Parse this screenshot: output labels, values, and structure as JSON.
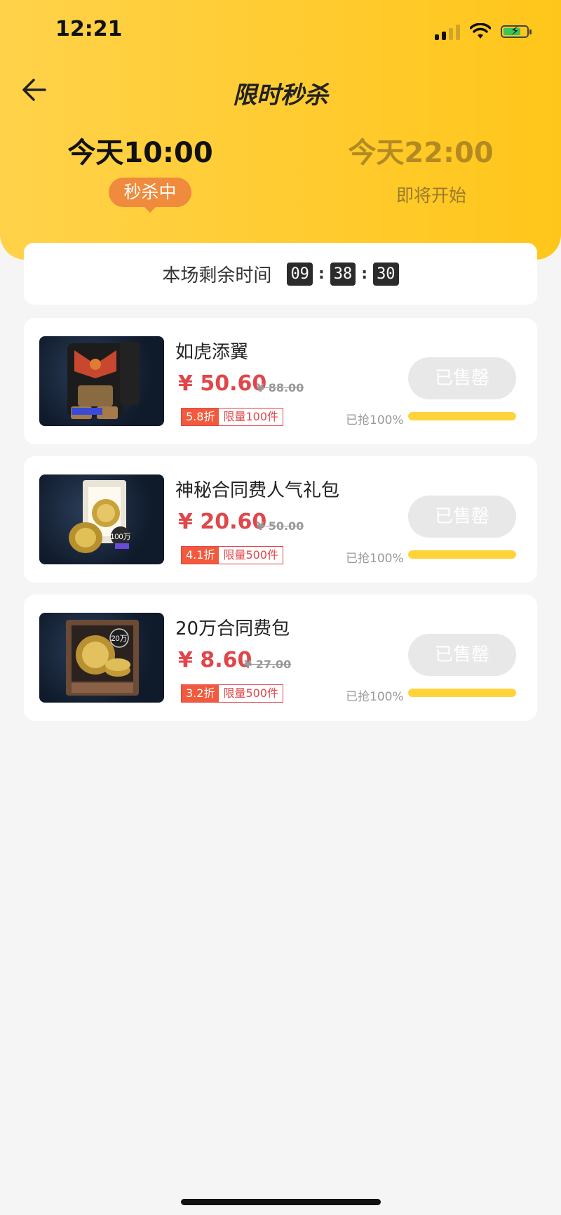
{
  "status_bar": {
    "time": "12:21"
  },
  "header": {
    "title": "限时秒杀"
  },
  "sessions": [
    {
      "label": "今天10:00",
      "status": "秒杀中",
      "active": true
    },
    {
      "label": "今天22:00",
      "status": "即将开始",
      "active": false
    }
  ],
  "timer": {
    "label": "本场剩余时间",
    "hours": "09",
    "minutes": "38",
    "seconds": "30"
  },
  "products": [
    {
      "name": "如虎添翼",
      "price": "¥ 50.60",
      "original_price": "¥ 88.00",
      "discount": "5.8折",
      "limit": "限量100件",
      "button": "已售罄",
      "sold_label": "已抢100%",
      "sold_progress": 1.0,
      "thumb_icon": "armor-gear-icon"
    },
    {
      "name": "神秘合同费人气礼包",
      "price": "¥ 20.60",
      "original_price": "¥ 50.00",
      "discount": "4.1折",
      "limit": "限量500件",
      "button": "已售罄",
      "sold_label": "已抢100%",
      "sold_progress": 1.0,
      "thumb_icon": "coin-gift-pack-icon"
    },
    {
      "name": "20万合同费包",
      "price": "¥ 8.60",
      "original_price": "¥ 27.00",
      "discount": "3.2折",
      "limit": "限量500件",
      "button": "已售罄",
      "sold_label": "已抢100%",
      "sold_progress": 1.0,
      "thumb_icon": "coin-box-icon"
    }
  ],
  "colors": {
    "accent_yellow": "#ffc61a",
    "price_red": "#e0464a",
    "pill_orange": "#f08a3c"
  }
}
